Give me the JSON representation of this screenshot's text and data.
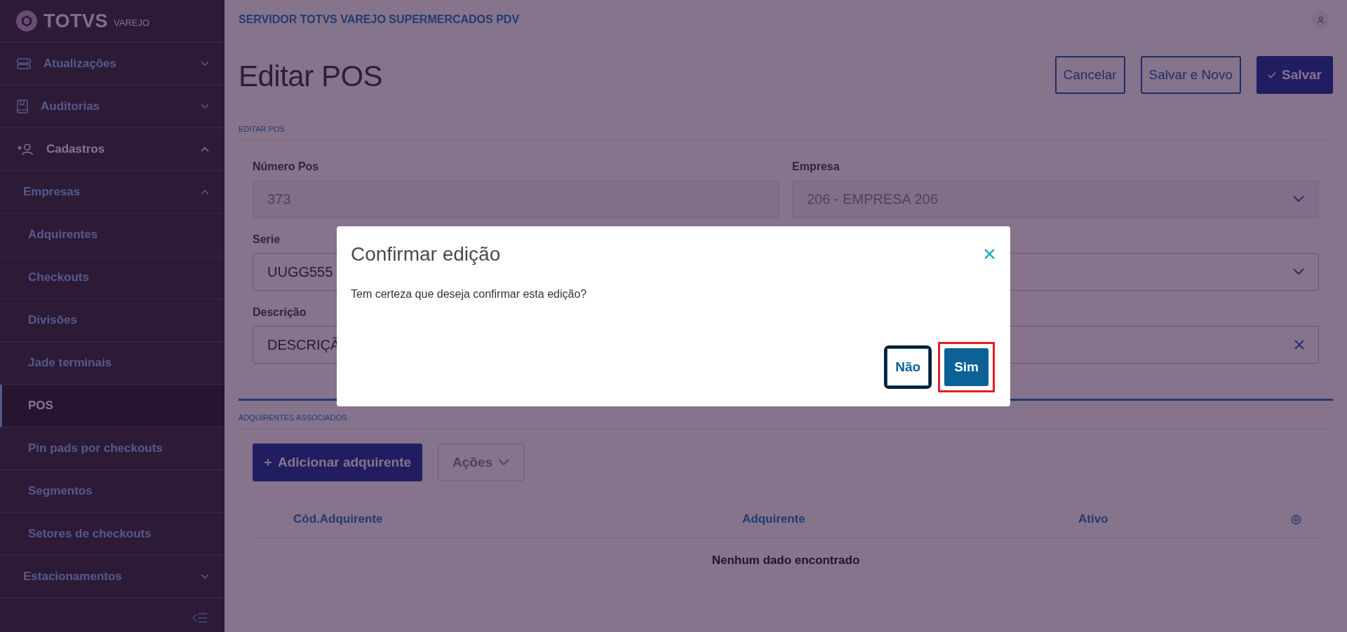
{
  "brand": {
    "name": "TOTVS",
    "sub": "VAREJO"
  },
  "sidebar": {
    "items": [
      {
        "label": "Atualizações",
        "expanded": false
      },
      {
        "label": "Auditorias",
        "expanded": false
      },
      {
        "label": "Cadastros",
        "expanded": true,
        "children": [
          {
            "label": "Empresas",
            "expanded": true,
            "children": [
              {
                "label": "Adquirentes",
                "selected": false
              },
              {
                "label": "Checkouts",
                "selected": false
              },
              {
                "label": "Divisões",
                "selected": false
              },
              {
                "label": "Jade terminais",
                "selected": false
              },
              {
                "label": "POS",
                "selected": true
              },
              {
                "label": "Pin pads por checkouts",
                "selected": false
              },
              {
                "label": "Segmentos",
                "selected": false
              },
              {
                "label": "Setores de checkouts",
                "selected": false
              }
            ]
          },
          {
            "label": "Estacionamentos",
            "expanded": false
          }
        ]
      }
    ]
  },
  "header": {
    "server": "SERVIDOR TOTVS VAREJO SUPERMERCADOS PDV"
  },
  "page": {
    "title": "Editar POS",
    "actions": [
      {
        "label": "Cancelar",
        "kind": "outline"
      },
      {
        "label": "Salvar e Novo",
        "kind": "outline"
      },
      {
        "label": "Salvar",
        "kind": "primary"
      }
    ],
    "section": "EDITAR POS",
    "fields": [
      {
        "label": "Número Pos",
        "value": "373",
        "kind": "text",
        "disabled": true
      },
      {
        "label": "Empresa",
        "value": "206 - EMPRESA 206",
        "kind": "select",
        "disabled": true
      },
      {
        "label": "Serie",
        "value": "UUGG555",
        "kind": "text",
        "disabled": false
      },
      {
        "kind": "select",
        "disabled": false
      },
      {
        "label": "Descrição",
        "value": "DESCRIÇÃ",
        "kind": "text",
        "disabled": false
      },
      {
        "kind": "clearable",
        "disabled": false
      }
    ]
  },
  "associated": {
    "section": "ADQUIRENTES ASSOCIADOS",
    "buttons": [
      {
        "label": "Adicionar adquirente",
        "kind": "primary"
      },
      {
        "label": "Ações",
        "kind": "dropdown",
        "disabled": true
      }
    ],
    "table": {
      "columns": [
        "Cód.Adquirente",
        "Adquirente",
        "Ativo"
      ],
      "empty": "Nenhum dado encontrado"
    }
  },
  "modal": {
    "title": "Confirmar edição",
    "message": "Tem certeza que deseja confirmar esta edição?",
    "buttons": [
      {
        "label": "Não",
        "kind": "outline",
        "focused": true,
        "highlighted": false
      },
      {
        "label": "Sim",
        "kind": "primary",
        "focused": false,
        "highlighted": true
      }
    ]
  }
}
